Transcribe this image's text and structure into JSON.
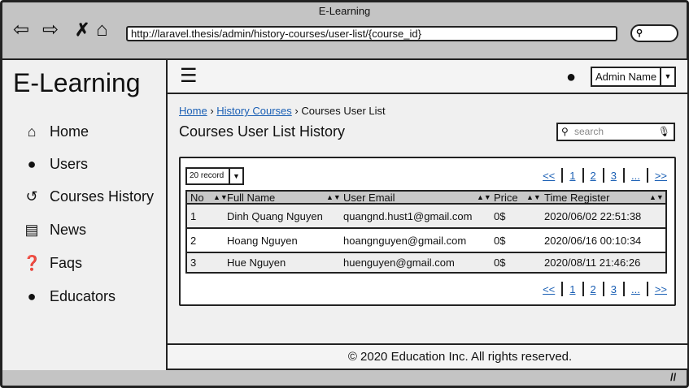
{
  "browser": {
    "title": "E-Learning",
    "url": "http://laravel.thesis/admin/history-courses/user-list/{course_id}"
  },
  "sidebar": {
    "logo": "E-Learning",
    "items": [
      {
        "label": "Home",
        "icon": "home-icon"
      },
      {
        "label": "Users",
        "icon": "user-icon"
      },
      {
        "label": "Courses History",
        "icon": "history-icon"
      },
      {
        "label": "News",
        "icon": "newspaper-icon"
      },
      {
        "label": "Faqs",
        "icon": "question-circle-icon"
      },
      {
        "label": "Educators",
        "icon": "user-icon"
      }
    ]
  },
  "header": {
    "user": "Admin Name"
  },
  "breadcrumb": [
    "Home",
    "History Courses",
    "Courses User List"
  ],
  "page_title": "Courses User List History",
  "search": {
    "placeholder": "search"
  },
  "records": "20 record",
  "pagination": [
    "<<",
    "1",
    "2",
    "3",
    "...",
    ">>"
  ],
  "table": {
    "columns": [
      "No",
      "Full Name",
      "User Email",
      "Price",
      "Time Register"
    ],
    "rows": [
      [
        "1",
        "Dinh Quang Nguyen",
        "quangnd.hust1@gmail.com",
        "0$",
        "2020/06/02 22:51:38"
      ],
      [
        "2",
        "Hoang Nguyen",
        "hoangnguyen@gmail.com",
        "0$",
        "2020/06/16 00:10:34"
      ],
      [
        "3",
        "Hue Nguyen",
        "huenguyen@gmail.com",
        "0$",
        "2020/08/11 21:46:26"
      ]
    ]
  },
  "footer": "© 2020 Education Inc. All rights reserved."
}
